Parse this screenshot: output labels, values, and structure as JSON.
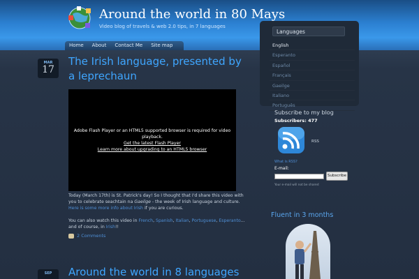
{
  "site": {
    "title": "Around the world in 80 Mays",
    "tagline": "Video blog of travels & web 2.0 tips, in 7 languages"
  },
  "nav": [
    "Home",
    "About",
    "Contact Me",
    "Site map"
  ],
  "post1": {
    "month": "MAR",
    "day": "17",
    "title": "The Irish language, presented by a leprechaun",
    "flash_msg": "Adobe Flash Player or an HTML5 supported browser is required for video playback.",
    "flash_link1": "Get the latest Flash Player",
    "flash_link2": "Learn more about upgrading to an HTML5 browser",
    "p1a": "Today (March 17th) is St. Patrick's day! So I thought that I'd share this video with you to celebrate seachtain na ",
    "p1b": "Gaeilge",
    "p1c": " - the week of Irish language and culture. ",
    "p1link": "Here is some more info about Irish",
    "p1d": " if you are curious.",
    "p2a": "You can also watch this video in ",
    "p2l1": "French",
    "p2l2": "Spanish",
    "p2l3": "Italian",
    "p2l4": "Portuguese",
    "p2l5": "Esperanto",
    "p2b": "... and of course, in ",
    "p2l6": "Irish",
    "p2c": "!!",
    "comments": "2 Comments"
  },
  "post2": {
    "month": "SEP",
    "title": "Around the world in 8 languages"
  },
  "sidebar": {
    "languages_heading": "Languages",
    "languages": [
      "English",
      "Esperanto",
      "Español",
      "Français",
      "Gaeilge",
      "Italiano",
      "Português"
    ],
    "subscribe_heading": "Subscribe to my blog",
    "subscribers": "Subscribers: 477",
    "rss_label": "RSS",
    "what_rss": "What is RSS?",
    "email_label": "E-mail:",
    "subscribe_button": "Subscribe",
    "spam_note": "Your e-mail will not be shared",
    "fluent_heading": "Fluent in 3 months"
  },
  "colors": {
    "accent": "#3fa6ff",
    "link": "#4f8fd6",
    "header_blue": "#2b7fd0",
    "background": "#232f41"
  }
}
